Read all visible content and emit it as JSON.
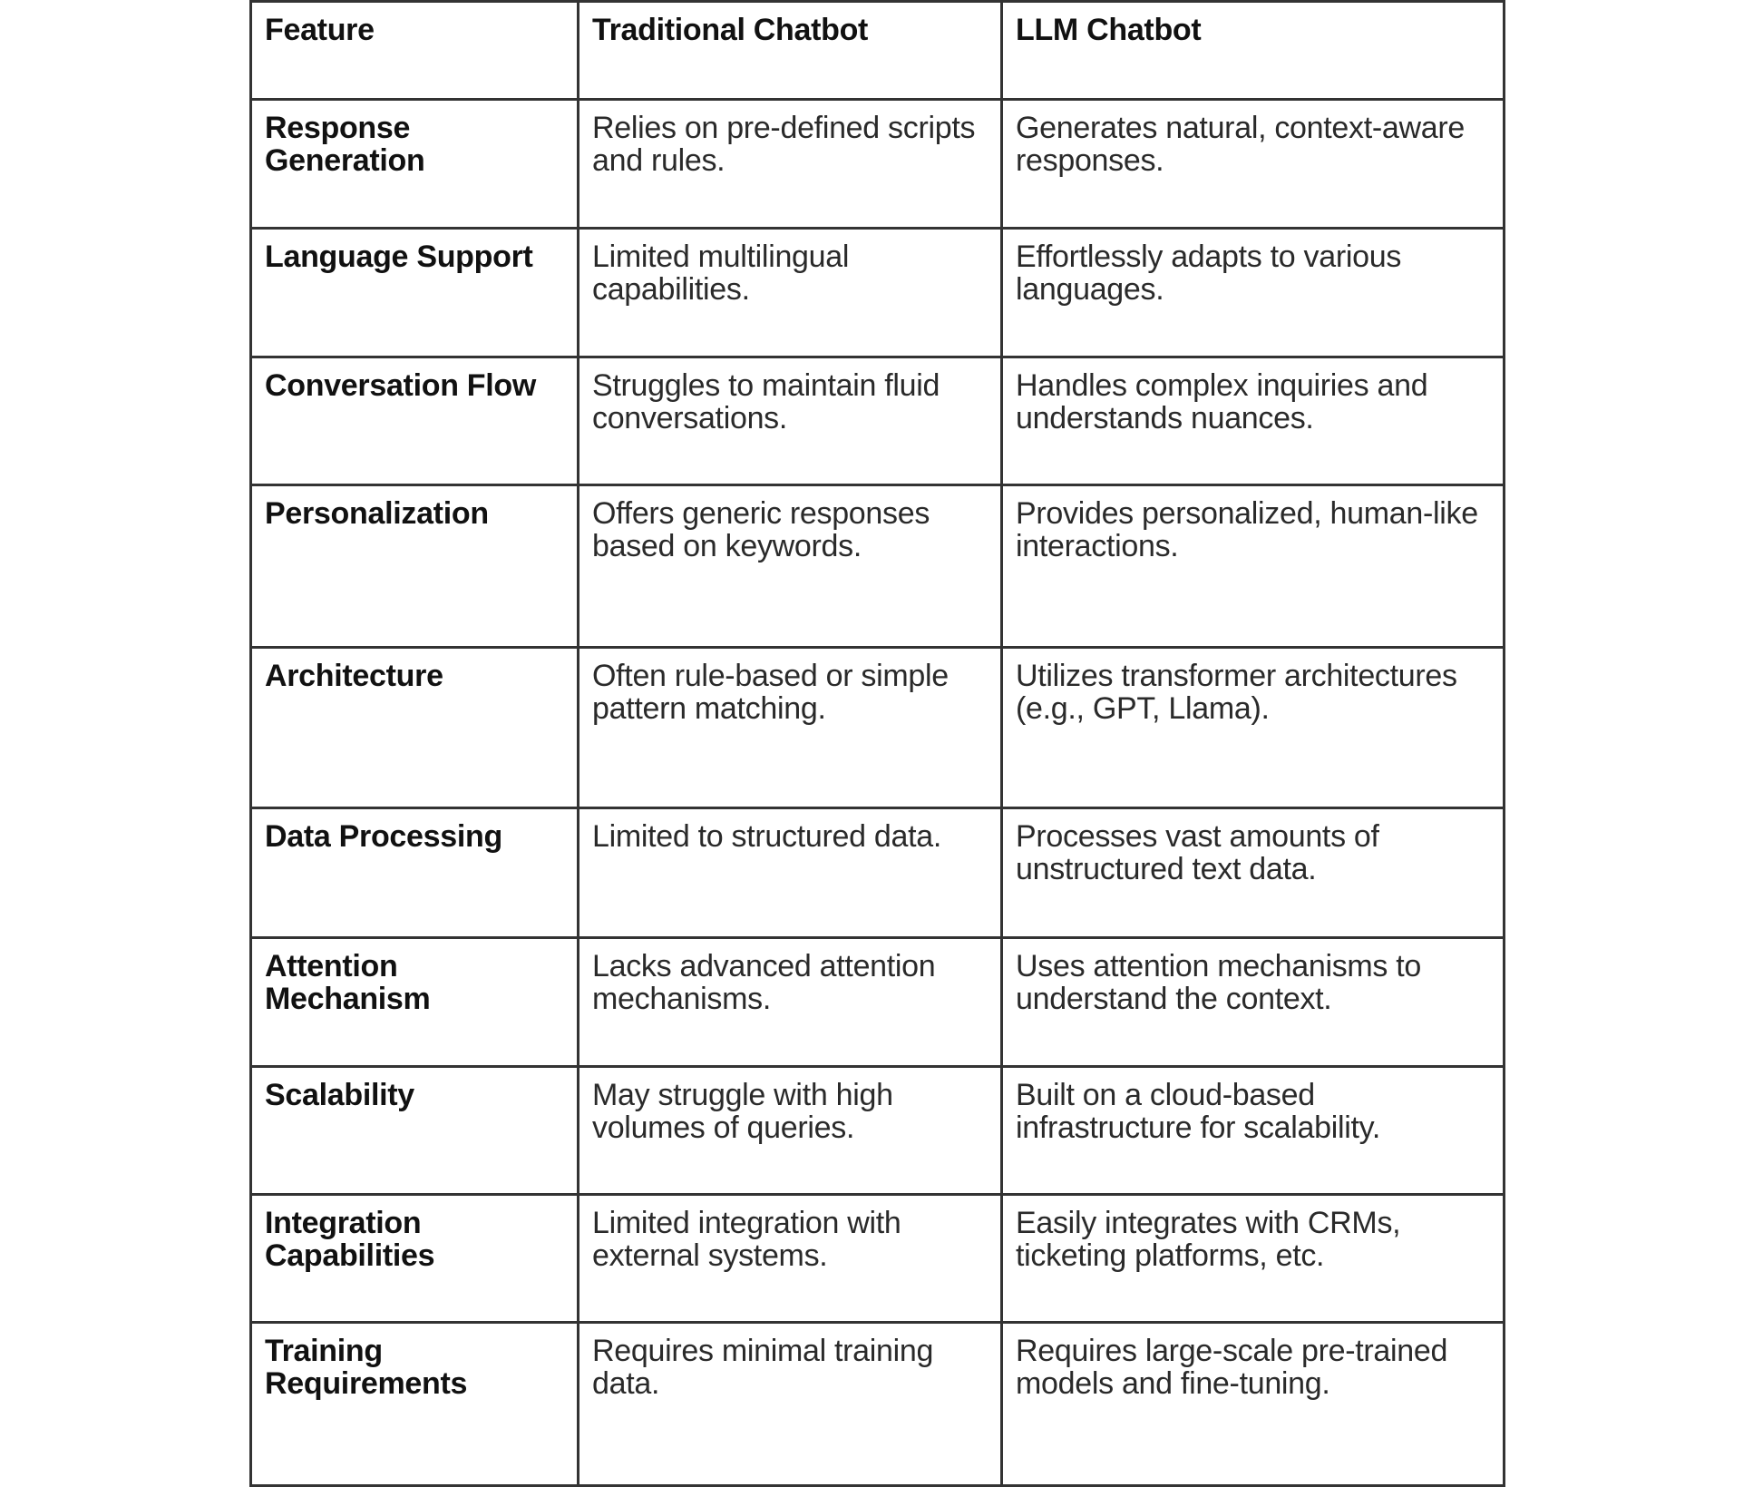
{
  "table": {
    "headers": [
      "Feature",
      "Traditional Chatbot",
      "LLM Chatbot"
    ],
    "rows": [
      {
        "feature": "Response Generation",
        "traditional": "Relies on pre-defined scripts and rules.",
        "llm": "Generates natural, context-aware responses."
      },
      {
        "feature": "Language Support",
        "traditional": "Limited multilingual capabilities.",
        "llm": "Effortlessly adapts to various languages."
      },
      {
        "feature": "Conversation Flow",
        "traditional": "Struggles to maintain fluid conversations.",
        "llm": "Handles complex inquiries and understands nuances."
      },
      {
        "feature": "Personalization",
        "traditional": "Offers generic responses based on keywords.",
        "llm": "Provides personalized, human-like interactions."
      },
      {
        "feature": "Architecture",
        "traditional": "Often rule-based or simple pattern matching.",
        "llm": "Utilizes transformer architectures (e.g., GPT, Llama)."
      },
      {
        "feature": "Data Processing",
        "traditional": "Limited to structured data.",
        "llm": "Processes vast amounts of unstructured text data."
      },
      {
        "feature": "Attention Mechanism",
        "traditional": "Lacks advanced attention mechanisms.",
        "llm": "Uses attention mechanisms to understand the context."
      },
      {
        "feature": "Scalability",
        "traditional": "May struggle with high volumes of queries.",
        "llm": "Built on a cloud-based infrastructure for scalability."
      },
      {
        "feature": "Integration Capabilities",
        "traditional": "Limited integration with external systems.",
        "llm": "Easily integrates with CRMs, ticketing platforms, etc."
      },
      {
        "feature": "Training Requirements",
        "traditional": "Requires minimal training data.",
        "llm": "Requires large-scale pre-trained models and fine-tuning."
      }
    ]
  }
}
